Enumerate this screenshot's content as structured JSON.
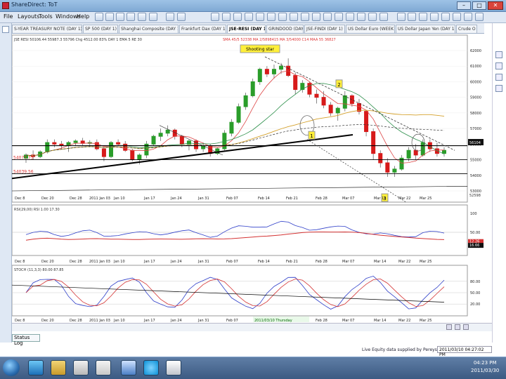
{
  "window": {
    "title": "ShareDirect: ToT"
  },
  "menu": [
    "File",
    "Layouts",
    "Tools",
    "Windows",
    "Help"
  ],
  "tabs": [
    "S-YEAR TREASURY NOTE (DAY 1)",
    "SP 500 (DAY 1)",
    "Shanghai Composite (DAY 1)",
    "Frankfurt Dax (DAY 1)",
    "JSE-RESI (DAY 1)",
    "GRINDOOD (DAY 1)",
    "JSE-FINDI (DAY 1)",
    "US Dollar Euro (WEEK 1)",
    "US Dollar Japan Yen (DAY 1)",
    "Crude O"
  ],
  "active_tab": 4,
  "price_panel": {
    "header": "JSE RESI 50106.44 55987.3 55796 Chg 4512.00 83% DAY 1 EMA 5 RE 30",
    "header_mas": "SMA 45/5 52338  MA 2/5898415  MA 3/54000 C14  MAA 55 36827",
    "annotations": {
      "shooting_star": "Shooting star",
      "label_1": "1",
      "label_2": "2",
      "label_3": "3"
    },
    "left_values": [
      "54077.73",
      "54039.56"
    ],
    "y_ticks": [
      "62000",
      "61000",
      "60000",
      "59000",
      "58000",
      "57000",
      "56000",
      "55000",
      "54000",
      "53000"
    ],
    "last_price": "56104",
    "right_tag": "52598"
  },
  "dates": [
    "Dec 8",
    "Dec 20",
    "Dec 28",
    "2011 Jan 03",
    "Jan 10",
    "Jan 17",
    "Jan 24",
    "Jan 31",
    "Feb 07",
    "Feb 14",
    "Feb 21",
    "Feb 28",
    "Mar 07",
    "Mar 14",
    "Mar 22",
    "Mar 25"
  ],
  "rsi_panel": {
    "header": "RSI(29,00) RSI 1.00 17.30",
    "y_ticks": [
      "100",
      "50.00"
    ],
    "tags": [
      "12.26",
      "16.66"
    ]
  },
  "stoch_panel": {
    "header": "STOCH (11,3,3) 80.00 87.85",
    "y_ticks": [
      "80.00",
      "50.00",
      "20.00"
    ]
  },
  "bottom_date": "2011/03/10 Thursday",
  "status": {
    "tab_label": "Status Log",
    "info": "Live Equity data supplied by Pereys",
    "datetime": "2011/03/10 04:27:02 PM"
  },
  "clock": {
    "time": "04:23 PM",
    "date": "2011/03/30"
  },
  "colors": {
    "up": "#2a9d2a",
    "down": "#d71a1a",
    "rsi": "#2f3fc9",
    "sig": "#d43333",
    "ema": "#d4a02a"
  }
}
